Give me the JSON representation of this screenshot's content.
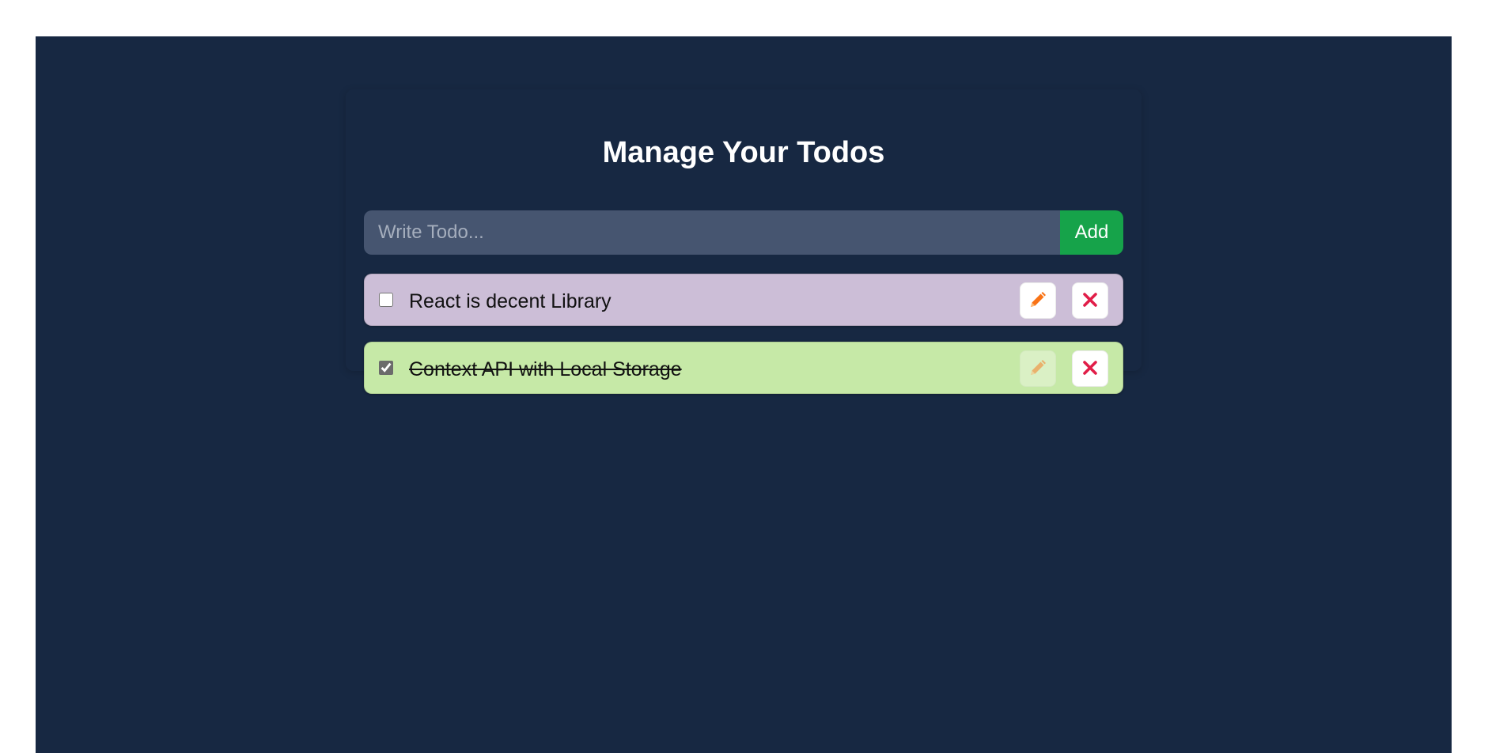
{
  "app": {
    "title": "Manage Your Todos"
  },
  "add_form": {
    "placeholder": "Write Todo...",
    "value": "",
    "add_label": "Add"
  },
  "todos": [
    {
      "text": "React is decent Library",
      "completed": false,
      "edit_icon": "pencil-icon",
      "delete_icon": "close-icon",
      "background": "#ccbed7"
    },
    {
      "text": "Context API with Local Storage",
      "completed": true,
      "edit_icon": "pencil-icon",
      "delete_icon": "close-icon",
      "background": "#c6e9a7"
    }
  ],
  "colors": {
    "page_background": "#172842",
    "input_background": "#465570",
    "add_button": "#16a34a",
    "pencil": "#f97316",
    "close": "#e11d48"
  }
}
